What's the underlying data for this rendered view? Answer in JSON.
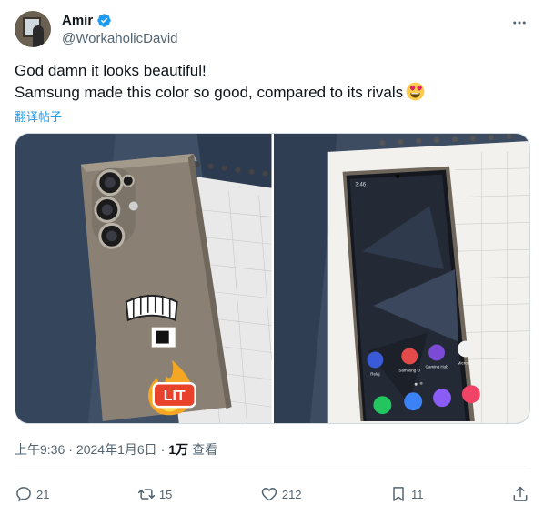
{
  "author": {
    "display_name": "Amir",
    "handle": "@WorkaholicDavid",
    "verified_icon": "verified-badge-icon",
    "badge_color": "#1d9bf0"
  },
  "tweet": {
    "line1": "God damn it looks beautiful!",
    "line2": "Samsung made this color so good, compared to its rivals",
    "emoji": "heart-eyes-emoji",
    "translate_label": "翻译帖子"
  },
  "media": {
    "photo1": {
      "sticker_text": "LIT"
    },
    "photo2": {
      "status_time": "3:46",
      "apps": [
        "Relaj",
        "Samsung O",
        "Gaming Hub",
        "Microsoft"
      ]
    }
  },
  "meta": {
    "time": "上午9:36",
    "separator": "·",
    "date": "2024年1月6日",
    "views_count": "1万",
    "views_label": "查看"
  },
  "actions": {
    "reply_count": "21",
    "retweet_count": "15",
    "like_count": "212",
    "bookmark_count": "11"
  },
  "colors": {
    "text_primary": "#0f1419",
    "text_secondary": "#536471",
    "link": "#1d9bf0"
  }
}
